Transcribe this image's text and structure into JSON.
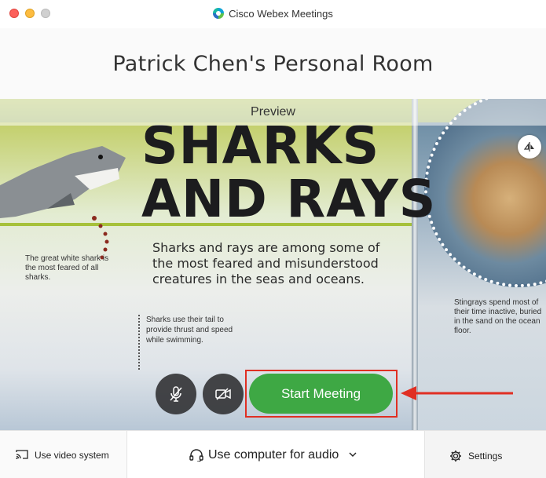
{
  "window": {
    "app_title": "Cisco Webex Meetings"
  },
  "room": {
    "title": "Patrick Chen's Personal Room"
  },
  "preview": {
    "label": "Preview",
    "book": {
      "title_line1": "SHARKS",
      "title_line2": "AND RAYS",
      "body": "Sharks and rays are among some of the most feared and misunderstood creatures in the seas and oceans.",
      "caption_left": "The great white shark is the most feared of all sharks.",
      "caption_tail": "Sharks use their tail to provide thrust and speed while swimming.",
      "caption_right": "Stingrays spend most of their time inactive, buried in the sand on the ocean floor."
    }
  },
  "controls": {
    "mute_icon": "mic-muted-icon",
    "video_icon": "video-camera-icon",
    "start_label": "Start Meeting",
    "highlight_color": "#e02f23",
    "start_color": "#3ea844"
  },
  "bottom_bar": {
    "video_system_label": "Use video system",
    "audio_label": "Use computer for audio",
    "settings_label": "Settings"
  }
}
